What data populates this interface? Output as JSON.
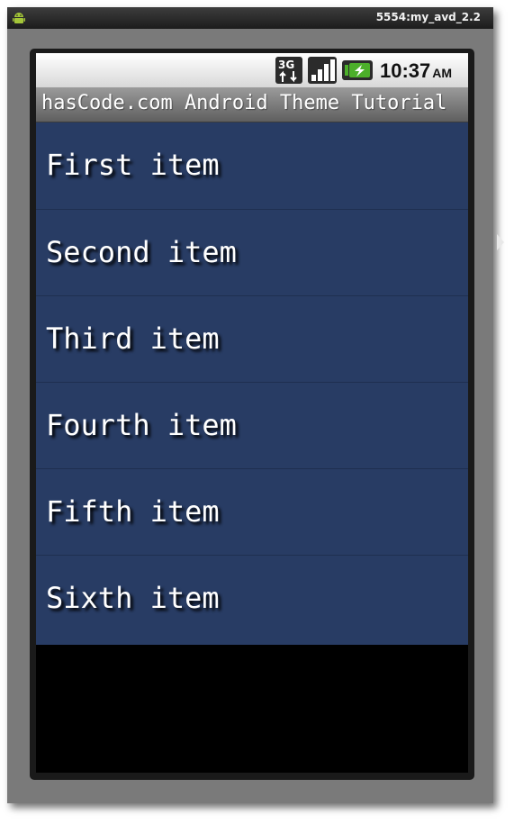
{
  "emulator": {
    "window_title": "5554:my_avd_2.2"
  },
  "status_bar": {
    "network_label": "3G",
    "time": "10:37",
    "ampm": "AM",
    "icons": [
      "3g-data-icon",
      "signal-strength-icon",
      "battery-charging-icon"
    ]
  },
  "app": {
    "title": "hasCode.com Android Theme Tutorial"
  },
  "list": {
    "items": [
      {
        "label": "First item"
      },
      {
        "label": "Second item"
      },
      {
        "label": "Third item"
      },
      {
        "label": "Fourth item"
      },
      {
        "label": "Fifth item"
      },
      {
        "label": "Sixth item"
      }
    ]
  },
  "colors": {
    "list_background": "#283c64",
    "titlebar": "#7a7a7a",
    "battery_accent": "#4caf2a"
  }
}
